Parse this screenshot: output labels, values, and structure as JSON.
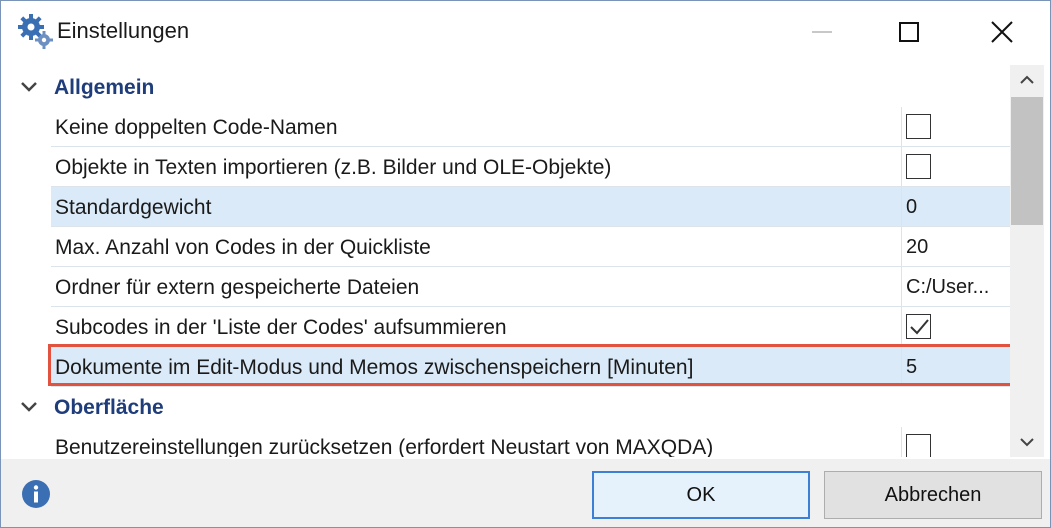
{
  "window": {
    "title": "Einstellungen",
    "icons": {
      "app": "gears-icon",
      "minimize": "minimize-icon",
      "maximize": "maximize-icon",
      "close": "close-icon"
    }
  },
  "sections": [
    {
      "title": "Allgemein",
      "icon": "chevron-down-icon"
    },
    {
      "title": "Oberfläche",
      "icon": "chevron-down-icon"
    }
  ],
  "rows": [
    {
      "label": "Keine doppelten Code-Namen",
      "type": "checkbox",
      "checked": false
    },
    {
      "label": "Objekte in Texten importieren (z.B. Bilder und OLE-Objekte)",
      "type": "checkbox",
      "checked": false
    },
    {
      "label": "Standardgewicht",
      "type": "value",
      "value": "0"
    },
    {
      "label": "Max. Anzahl von Codes in der Quickliste",
      "type": "value",
      "value": "20"
    },
    {
      "label": "Ordner für extern gespeicherte Dateien",
      "type": "value",
      "value": "C:/User..."
    },
    {
      "label": "Subcodes in der 'Liste der Codes' aufsummieren",
      "type": "checkbox",
      "checked": true
    },
    {
      "label": "Dokumente im Edit-Modus und Memos zwischenspeichern [Minuten]",
      "type": "value",
      "value": "5"
    },
    {
      "label": "Benutzereinstellungen zurücksetzen (erfordert Neustart von MAXQDA)",
      "type": "checkbox",
      "checked": false
    }
  ],
  "footer": {
    "info_icon": "info-icon",
    "ok_label": "OK",
    "cancel_label": "Abbrechen"
  },
  "colors": {
    "section_title": "#1f3d7a",
    "highlight": "#e2533f",
    "selected_row": "#dbeaf8",
    "primary_border": "#3c7fd6"
  }
}
